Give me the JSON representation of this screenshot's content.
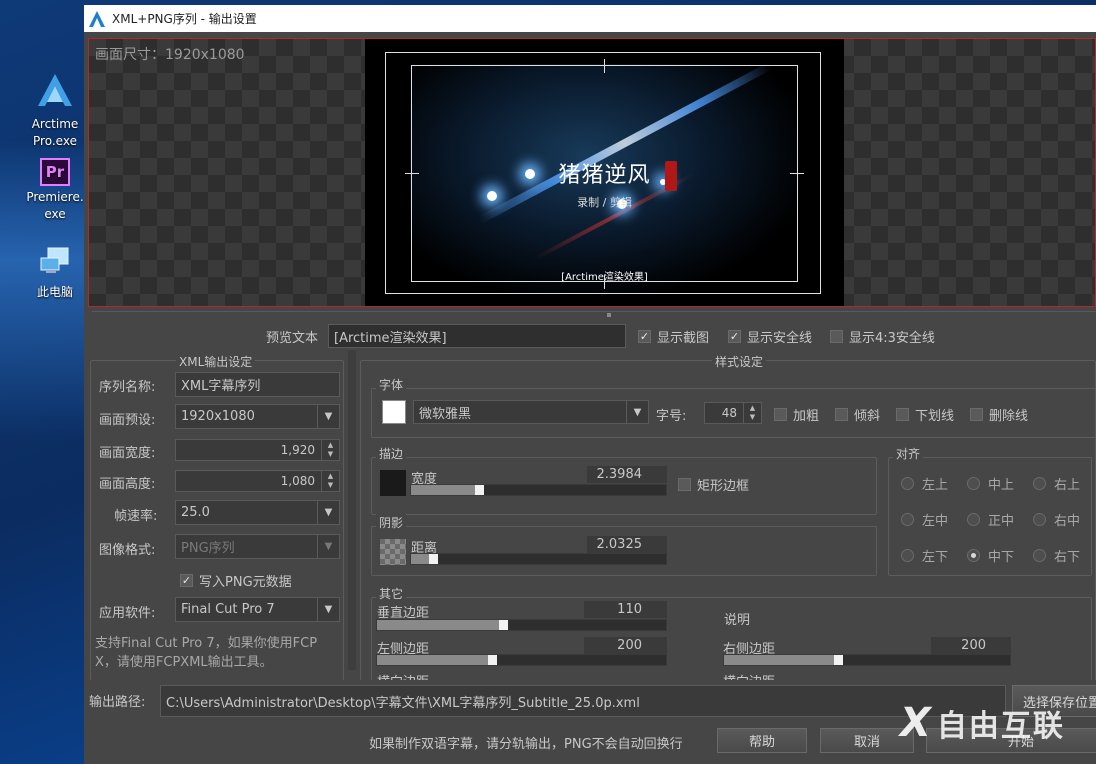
{
  "desktop": {
    "icons": [
      {
        "name": "Arctime Pro.exe",
        "line1": "Arctime",
        "line2": "Pro.exe"
      },
      {
        "name": "Premiere.exe",
        "line1": "Premiere.",
        "line2": "exe",
        "glyph": "Pr"
      },
      {
        "name": "此电脑",
        "line1": "此电脑"
      }
    ]
  },
  "window": {
    "title": "XML+PNG序列 - 输出设置"
  },
  "preview": {
    "size_label": "画面尺寸：1920x1080",
    "title_text": "猪猪逆风",
    "sub_text": "录制 / 剪辑",
    "subtitle_text": "[Arctime渲染效果]"
  },
  "preview_controls": {
    "preview_text_label": "预览文本",
    "preview_text_value": "[Arctime渲染效果]",
    "show_screenshot": {
      "label": "显示截图",
      "checked": true
    },
    "show_safe_line": {
      "label": "显示安全线",
      "checked": true
    },
    "show_43_safe_line": {
      "label": "显示4:3安全线",
      "checked": false
    }
  },
  "xml_settings": {
    "group_title": "XML输出设定",
    "sequence_name_label": "序列名称:",
    "sequence_name_value": "XML字幕序列",
    "preset_label": "画面预设:",
    "preset_value": "1920x1080",
    "width_label": "画面宽度:",
    "width_value": "1,920",
    "height_label": "画面高度:",
    "height_value": "1,080",
    "fps_label": "帧速率:",
    "fps_value": "25.0",
    "image_format_label": "图像格式:",
    "image_format_value": "PNG序列",
    "write_png_meta": {
      "label": "写入PNG元数据",
      "checked": true
    },
    "app_label": "应用软件:",
    "app_value": "Final Cut Pro 7",
    "note_line1": "支持Final Cut Pro 7，如果你使用FCP",
    "note_line2": "X，请使用FCPXML输出工具。"
  },
  "style_settings": {
    "group_title": "样式设定",
    "font_group": "字体",
    "font_color": "#ffffff",
    "font_name": "微软雅黑",
    "font_size_label": "字号:",
    "font_size_value": "48",
    "bold": {
      "label": "加粗",
      "checked": false
    },
    "italic": {
      "label": "倾斜",
      "checked": false
    },
    "underline": {
      "label": "下划线",
      "checked": false
    },
    "strikethrough": {
      "label": "删除线",
      "checked": false
    },
    "stroke_group": "描边",
    "stroke_width_label": "宽度",
    "stroke_width_value": "2.3984",
    "stroke_width_fraction": 0.26,
    "rect_border": {
      "label": "矩形边框",
      "checked": false
    },
    "shadow_group": "阴影",
    "shadow_distance_label": "距离",
    "shadow_distance_value": "2.0325",
    "shadow_distance_fraction": 0.08,
    "align_group": "对齐",
    "align_options": [
      {
        "label": "左上",
        "selected": false
      },
      {
        "label": "中上",
        "selected": false
      },
      {
        "label": "右上",
        "selected": false
      },
      {
        "label": "左中",
        "selected": false
      },
      {
        "label": "正中",
        "selected": false
      },
      {
        "label": "右中",
        "selected": false
      },
      {
        "label": "左下",
        "selected": false
      },
      {
        "label": "中下",
        "selected": true
      },
      {
        "label": "右下",
        "selected": false
      }
    ],
    "other_group": "其它",
    "vertical_margin_label": "垂直边距",
    "vertical_margin_value": "110",
    "vertical_margin_fraction": 0.43,
    "left_margin_label": "左侧边距",
    "left_margin_value": "200",
    "left_margin_fraction": 0.39,
    "description_label": "说明",
    "right_margin_label": "右侧边距",
    "right_margin_value": "200",
    "right_margin_fraction": 0.39,
    "cut_row_left": "横向边距",
    "cut_row_right": "横向边距"
  },
  "footer": {
    "output_path_label": "输出路径:",
    "output_path_value": "C:\\Users\\Administrator\\Desktop\\字幕文件\\XML字幕序列_Subtitle_25.0p.xml",
    "choose_location_button": "选择保存位置",
    "hint": "如果制作双语字幕，请分轨输出，PNG不会自动回换行",
    "help_button": "帮助",
    "cancel_button": "取消",
    "start_button": "开始"
  },
  "watermark": {
    "text": "自由互联",
    "mark": "X"
  },
  "colors": {
    "accent_red": "#b02a2a",
    "panel_bg": "#464646",
    "field_bg": "#3a3a3a"
  }
}
